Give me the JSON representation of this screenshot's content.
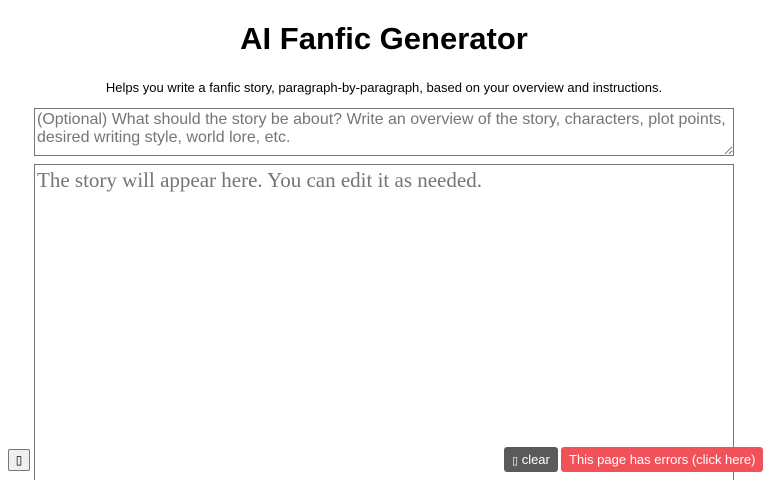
{
  "header": {
    "title": "AI Fanfic Generator",
    "subtitle": "Helps you write a fanfic story, paragraph-by-paragraph, based on your overview and instructions."
  },
  "overview_input": {
    "placeholder": "(Optional) What should the story be about? Write an overview of the story, characters, plot points, desired writing style, world lore, etc.",
    "value": ""
  },
  "story_area": {
    "placeholder": "The story will appear here. You can edit it as needed.",
    "value": ""
  },
  "footer": {
    "corner_button_glyph": "▯",
    "clear_icon_glyph": "▯",
    "clear_label": "clear",
    "error_label": "This page has errors (click here)"
  },
  "colors": {
    "clear_button_bg": "#5a5a5a",
    "error_button_bg": "#f1525a"
  }
}
